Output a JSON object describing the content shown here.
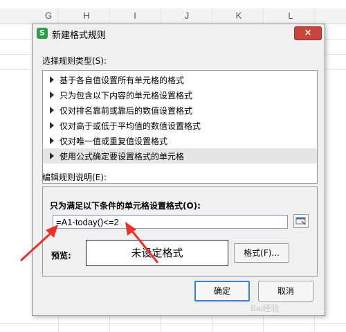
{
  "spreadsheet": {
    "columns": [
      "G",
      "H",
      "I",
      "J",
      "K",
      "L"
    ]
  },
  "dialog": {
    "app_icon": "S",
    "title": "新建格式规则",
    "close_glyph": "×",
    "rule_type_label": "选择规则类型(S):",
    "rule_types": [
      "基于各自值设置所有单元格的格式",
      "只为包含以下内容的单元格设置格式",
      "仅对排名靠前或靠后的数值设置格式",
      "仅对高于或低于平均值的数值设置格式",
      "仅对唯一值或重复值设置格式",
      "使用公式确定要设置格式的单元格"
    ],
    "selected_rule_index": 5,
    "edit_desc_label": "编辑规则说明(E):",
    "condition_label": "只为满足以下条件的单元格设置格式(O):",
    "formula_value": "=A1-today()<=2",
    "preview_label": "预览:",
    "preview_text": "未设定格式",
    "format_button": "格式(F)...",
    "ok_button": "确定",
    "cancel_button": "取消"
  },
  "annotation_color": "#e8322b",
  "watermark": "Bai经验"
}
